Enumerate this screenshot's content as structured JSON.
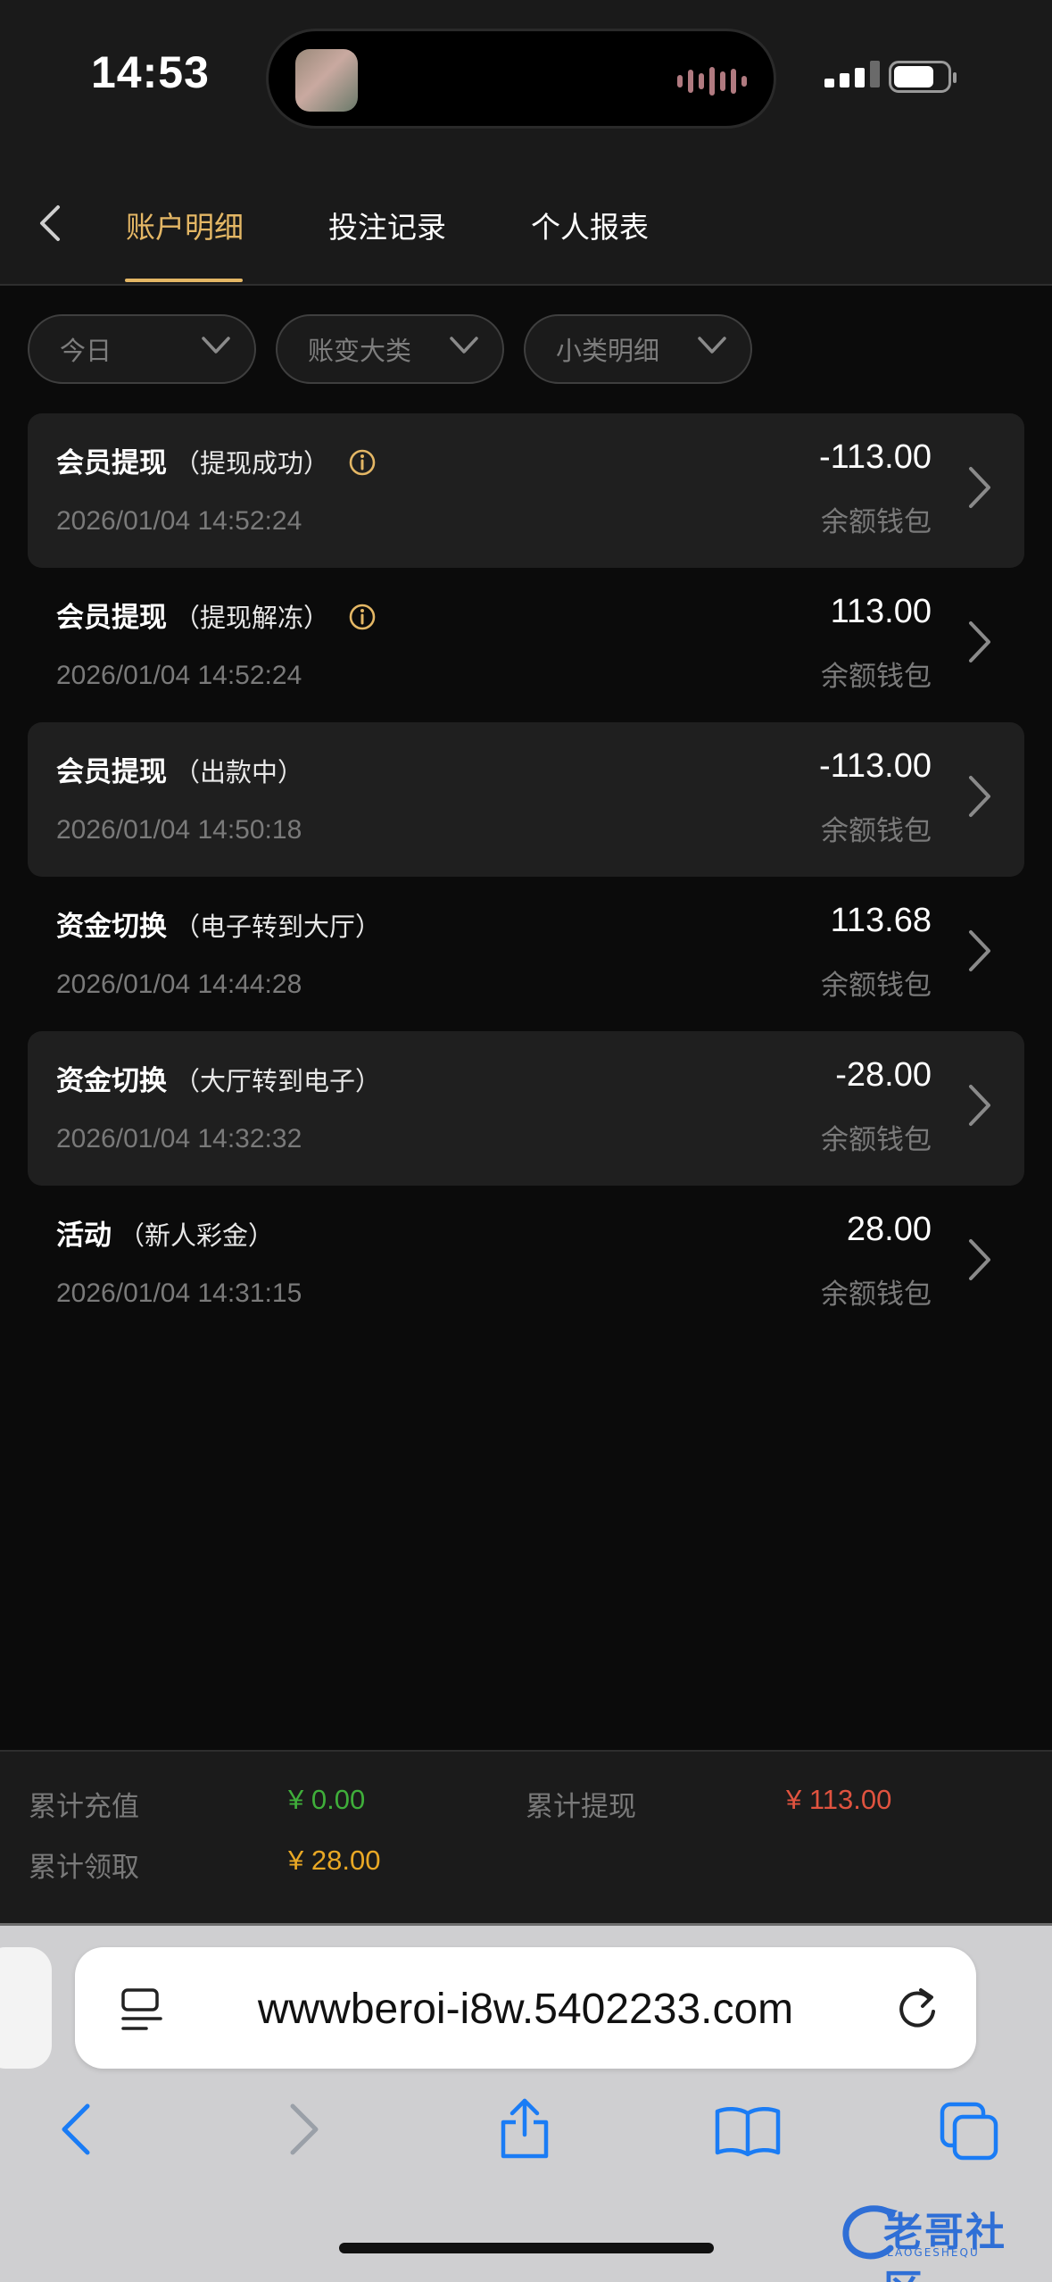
{
  "status_bar": {
    "time": "14:53"
  },
  "header": {
    "tabs": [
      {
        "label": "账户明细",
        "active": true
      },
      {
        "label": "投注记录",
        "active": false
      },
      {
        "label": "个人报表",
        "active": false
      }
    ],
    "accent_color": "#e4b765"
  },
  "filters": [
    {
      "label": "今日"
    },
    {
      "label": "账变大类"
    },
    {
      "label": "小类明细"
    }
  ],
  "transactions": [
    {
      "title": "会员提现",
      "subtitle": "（提现成功）",
      "has_info": true,
      "date": "2026/01/04 14:52:24",
      "amount": "-113.00",
      "wallet": "余额钱包"
    },
    {
      "title": "会员提现",
      "subtitle": "（提现解冻）",
      "has_info": true,
      "date": "2026/01/04 14:52:24",
      "amount": "113.00",
      "wallet": "余额钱包"
    },
    {
      "title": "会员提现",
      "subtitle": "（出款中）",
      "has_info": false,
      "date": "2026/01/04 14:50:18",
      "amount": "-113.00",
      "wallet": "余额钱包"
    },
    {
      "title": "资金切换",
      "subtitle": "（电子转到大厅）",
      "has_info": false,
      "date": "2026/01/04 14:44:28",
      "amount": "113.68",
      "wallet": "余额钱包"
    },
    {
      "title": "资金切换",
      "subtitle": "（大厅转到电子）",
      "has_info": false,
      "date": "2026/01/04 14:32:32",
      "amount": "-28.00",
      "wallet": "余额钱包"
    },
    {
      "title": "活动",
      "subtitle": "（新人彩金）",
      "has_info": false,
      "date": "2026/01/04 14:31:15",
      "amount": "28.00",
      "wallet": "余额钱包"
    }
  ],
  "summary": {
    "recharge_label": "累计充值",
    "recharge_value": "¥ 0.00",
    "recharge_color": "#3fae3a",
    "withdraw_label": "累计提现",
    "withdraw_value": "¥ 113.00",
    "withdraw_color": "#e0533f",
    "claim_label": "累计领取",
    "claim_value": "¥ 28.00",
    "claim_color": "#e9a825"
  },
  "browser": {
    "url": "wwwberoi-i8w.5402233.com",
    "toolbar_icons": [
      "back-icon",
      "forward-icon",
      "share-icon",
      "bookmarks-icon",
      "tabs-icon"
    ],
    "icon_color": "#1a7cf5"
  },
  "watermark": {
    "text": "老哥社区",
    "sub": "LAOGESHEQU"
  }
}
